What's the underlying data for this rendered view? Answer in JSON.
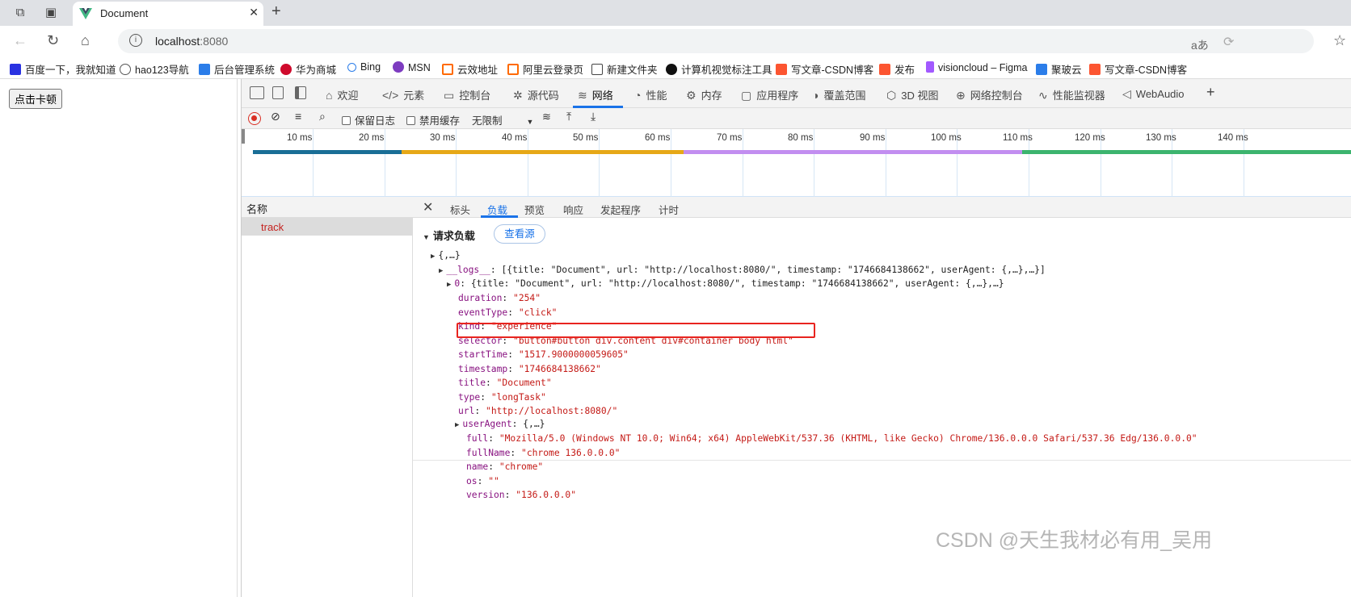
{
  "browser": {
    "tab_title": "Document",
    "url_host": "localhost",
    "url_port": ":8080",
    "read_aloud_icon": "aあ"
  },
  "bookmarks": [
    {
      "label": "百度一下，我就知道",
      "color": "#2932e1"
    },
    {
      "label": "hao123导航",
      "color": "#555555"
    },
    {
      "label": "后台管理系统",
      "color": "#2b7de9"
    },
    {
      "label": "华为商城",
      "color": "#cf0a2c"
    },
    {
      "label": "Bing",
      "color": "#2b7de9"
    },
    {
      "label": "MSN",
      "color": "#7d3cc0"
    },
    {
      "label": "云效地址",
      "color": "#ff6a00"
    },
    {
      "label": "阿里云登录页",
      "color": "#ff6a00"
    },
    {
      "label": "新建文件夹",
      "color": "#444444"
    },
    {
      "label": "计算机视觉标注工具",
      "color": "#111111"
    },
    {
      "label": "写文章-CSDN博客",
      "color": "#fc5531"
    },
    {
      "label": "发布",
      "color": "#fc5531"
    },
    {
      "label": "visioncloud – Figma",
      "color": "#a259ff"
    },
    {
      "label": "聚玻云",
      "color": "#2b7de9"
    },
    {
      "label": "写文章-CSDN博客",
      "color": "#fc5531"
    }
  ],
  "page": {
    "button_label": "点击卡顿"
  },
  "devtools": {
    "tabs": [
      "欢迎",
      "元素",
      "控制台",
      "源代码",
      "网络",
      "性能",
      "内存",
      "应用程序",
      "覆盖范围",
      "3D 视图",
      "网络控制台",
      "性能监视器",
      "WebAudio"
    ],
    "active_tab": "网络",
    "toolbar": {
      "preserve_log": "保留日志",
      "disable_cache": "禁用缓存",
      "throttling": "无限制"
    },
    "timeline_ticks": [
      "10 ms",
      "20 ms",
      "30 ms",
      "40 ms",
      "50 ms",
      "60 ms",
      "70 ms",
      "80 ms",
      "90 ms",
      "100 ms",
      "110 ms",
      "120 ms",
      "130 ms",
      "140 ms"
    ],
    "timeline_colors": {
      "blue": "#1a6e96",
      "orange": "#e6a817",
      "purple": "#c28ef0",
      "green": "#3cb46e"
    },
    "list_header": "名称",
    "requests": [
      "track"
    ],
    "detail_tabs": [
      "标头",
      "负载",
      "预览",
      "响应",
      "发起程序",
      "计时"
    ],
    "active_detail_tab": "负载",
    "payload_title": "请求负载",
    "view_source": "查看源",
    "payload": {
      "root": "{,…}",
      "logs_key": "__logs__",
      "logs_summary": "[{title: \"Document\", url: \"http://localhost:8080/\", timestamp: \"1746684138662\", userAgent: {,…},…}]",
      "item_key": "0",
      "item_summary": "{title: \"Document\", url: \"http://localhost:8080/\", timestamp: \"1746684138662\", userAgent: {,…},…}",
      "fields": [
        {
          "key": "duration",
          "value": "\"254\""
        },
        {
          "key": "eventType",
          "value": "\"click\""
        },
        {
          "key": "kind",
          "value": "\"experience\""
        },
        {
          "key": "selector",
          "value": "\"button#button div.content div#container body html\""
        },
        {
          "key": "startTime",
          "value": "\"1517.9000000059605\""
        },
        {
          "key": "timestamp",
          "value": "\"1746684138662\""
        },
        {
          "key": "title",
          "value": "\"Document\""
        },
        {
          "key": "type",
          "value": "\"longTask\""
        },
        {
          "key": "url",
          "value": "\"http://localhost:8080/\""
        }
      ],
      "user_agent_key": "userAgent",
      "user_agent_summary": "{,…}",
      "user_agent_fields": [
        {
          "key": "full",
          "value": "\"Mozilla/5.0 (Windows NT 10.0; Win64; x64) AppleWebKit/537.36 (KHTML, like Gecko) Chrome/136.0.0.0 Safari/537.36 Edg/136.0.0.0\""
        },
        {
          "key": "fullName",
          "value": "\"chrome 136.0.0.0\""
        },
        {
          "key": "name",
          "value": "\"chrome\""
        },
        {
          "key": "os",
          "value": "\"\""
        },
        {
          "key": "version",
          "value": "\"136.0.0.0\""
        }
      ]
    }
  },
  "watermark": "CSDN @天生我材必有用_吴用"
}
